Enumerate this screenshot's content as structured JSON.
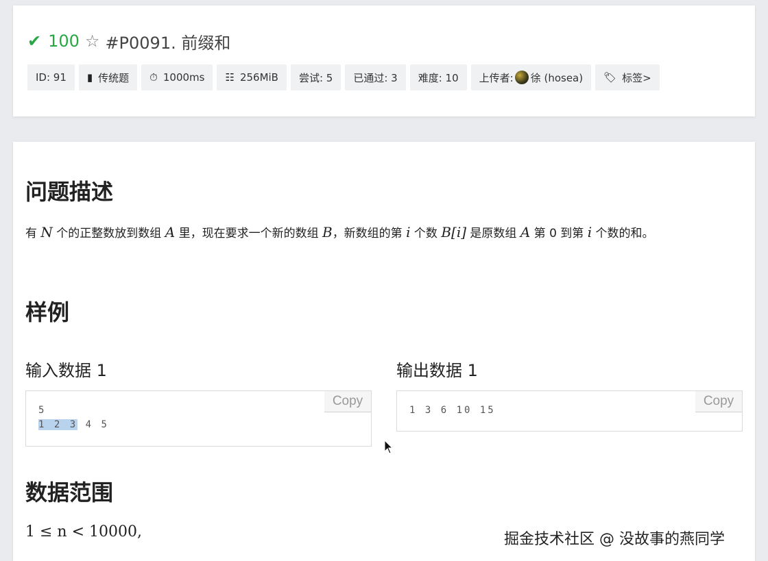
{
  "header": {
    "score": "100",
    "title": "#P0091. 前缀和",
    "tags": [
      {
        "icon": "",
        "label": "ID: 91"
      },
      {
        "icon": "book-icon",
        "label": "传统题"
      },
      {
        "icon": "timer-icon",
        "label": "1000ms"
      },
      {
        "icon": "memory-icon",
        "label": "256MiB"
      },
      {
        "icon": "",
        "label": "尝试: 5"
      },
      {
        "icon": "",
        "label": "已通过: 3"
      },
      {
        "icon": "",
        "label": "难度: 10"
      },
      {
        "icon": "avatar",
        "label_prefix": "上传者:",
        "label": "徐 (hosea)"
      },
      {
        "icon": "tag-icon",
        "label": "标签>"
      }
    ]
  },
  "content": {
    "desc_heading": "问题描述",
    "desc": {
      "p1": "有",
      "N": "N",
      "p2": " 个的正整数放到数组 ",
      "A": "A",
      "p3": " 里，现在要求一个新的数组 ",
      "B": "B",
      "p4": "，新数组的第 ",
      "i": "i",
      "p5": " 个数 ",
      "Bi": "B[i]",
      "p6": " 是原数组 ",
      "A2": "A",
      "p7": " 第 0 到第 ",
      "i2": "i",
      "p8": " 个数的和。"
    },
    "sample_heading": "样例",
    "input_label": "输入数据 1",
    "output_label": "输出数据 1",
    "copy_label": "Copy",
    "input_line1": "5",
    "input_line2_selected": "1 2 3",
    "input_line2_rest": " 4 5",
    "output_line1": "1 3 6 10 15",
    "range_heading": "数据范围",
    "range_text": "1 ≤ n < 10000,"
  },
  "watermark": "掘金技术社区 @ 没故事的燕同学"
}
